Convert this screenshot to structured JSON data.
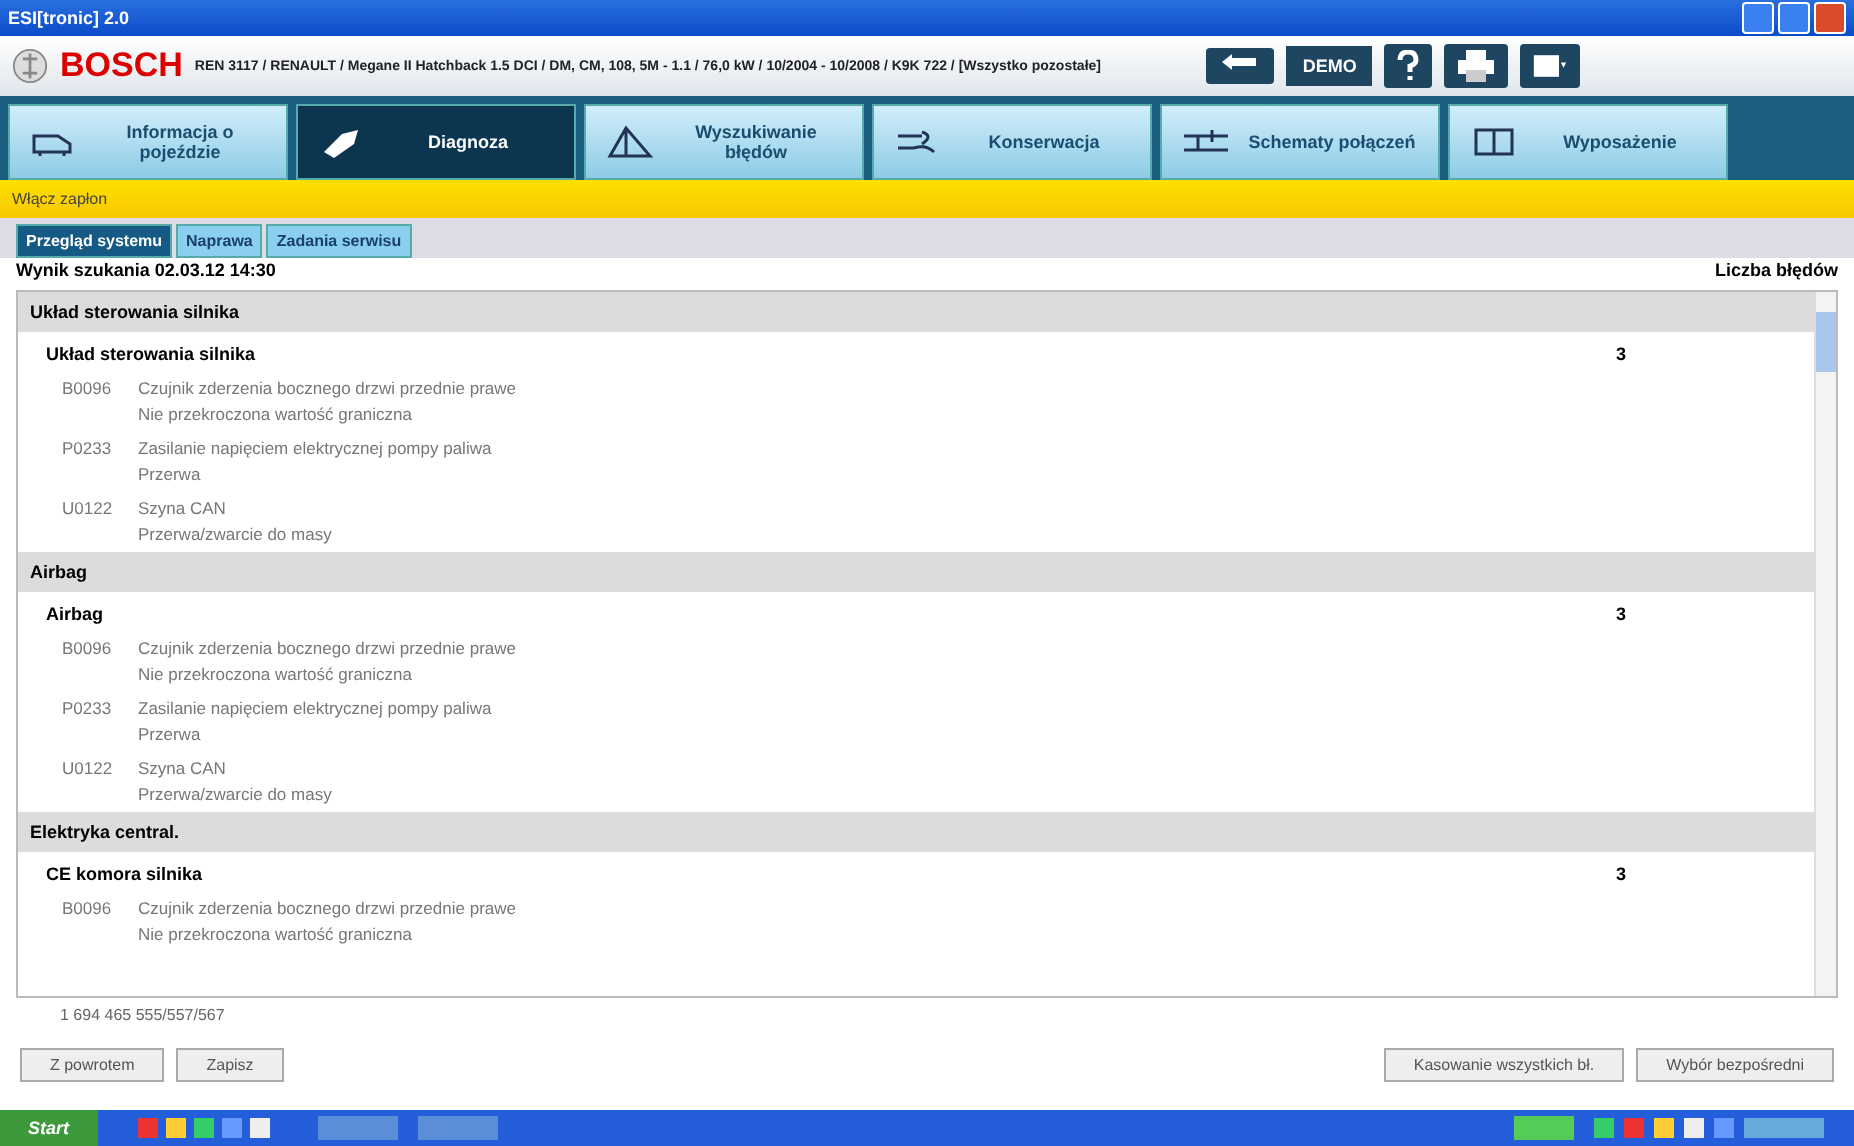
{
  "window": {
    "title": "ESI[tronic] 2.0"
  },
  "header": {
    "brand": "BOSCH",
    "vehicle": "REN 3117 / RENAULT / Megane II Hatchback 1.5 DCI / DM, CM, 108, 5M - 1.1 / 76,0 kW / 10/2004 - 10/2008 / K9K 722 / [Wszystko pozostałe]",
    "mode": "DEMO"
  },
  "tabs": [
    {
      "label": "Informacja o pojeździe",
      "selected": false
    },
    {
      "label": "Diagnoza",
      "selected": true
    },
    {
      "label": "Wyszukiwanie błędów",
      "selected": false
    },
    {
      "label": "Konserwacja",
      "selected": false
    },
    {
      "label": "Schematy połączeń",
      "selected": false
    },
    {
      "label": "Wyposażenie",
      "selected": false
    }
  ],
  "notice": "Włącz zapłon",
  "subtabs": [
    {
      "label": "Przegląd systemu",
      "selected": true
    },
    {
      "label": "Naprawa",
      "selected": false
    },
    {
      "label": "Zadania serwisu",
      "selected": false
    }
  ],
  "result_label": "Wynik szukania  02.03.12  14:30",
  "count_heading": "Liczba błędów",
  "groups": [
    {
      "name": "Układ sterowania silnika",
      "units": [
        {
          "name": "Układ sterowania silnika",
          "count": "3",
          "faults": [
            {
              "code": "B0096",
              "text": "Czujnik zderzenia bocznego drzwi przednie prawe",
              "detail": "Nie przekroczona wartość graniczna"
            },
            {
              "code": "P0233",
              "text": "Zasilanie napięciem elektrycznej pompy paliwa",
              "detail": "Przerwa"
            },
            {
              "code": "U0122",
              "text": "Szyna CAN",
              "detail": "Przerwa/zwarcie do masy"
            }
          ]
        }
      ]
    },
    {
      "name": "Airbag",
      "units": [
        {
          "name": "Airbag",
          "count": "3",
          "faults": [
            {
              "code": "B0096",
              "text": "Czujnik zderzenia bocznego drzwi przednie prawe",
              "detail": "Nie przekroczona wartość graniczna"
            },
            {
              "code": "P0233",
              "text": "Zasilanie napięciem elektrycznej pompy paliwa",
              "detail": "Przerwa"
            },
            {
              "code": "U0122",
              "text": "Szyna CAN",
              "detail": "Przerwa/zwarcie do masy"
            }
          ]
        }
      ]
    },
    {
      "name": "Elektryka central.",
      "units": [
        {
          "name": "CE komora silnika",
          "count": "3",
          "faults": [
            {
              "code": "B0096",
              "text": "Czujnik zderzenia bocznego drzwi przednie prawe",
              "detail": "Nie przekroczona wartość graniczna"
            }
          ]
        }
      ]
    }
  ],
  "part_number": "1 694 465 555/557/567",
  "buttons_left": [
    "Z powrotem",
    "Zapisz"
  ],
  "buttons_right": [
    "Kasowanie wszystkich bł.",
    "Wybór bezpośredni"
  ],
  "taskbar": {
    "start": "Start"
  }
}
